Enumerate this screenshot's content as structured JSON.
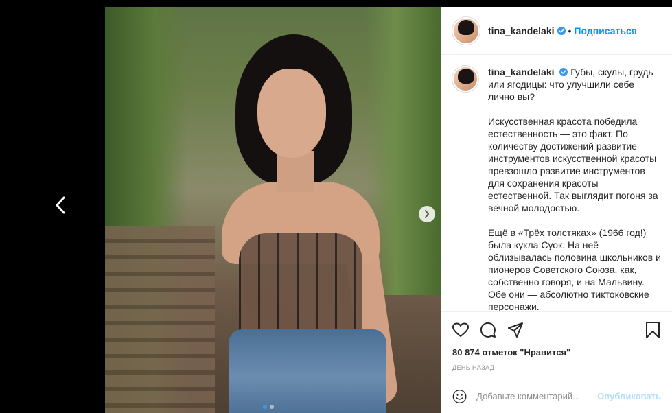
{
  "post": {
    "username": "tina_kandelaki",
    "follow_label": "Подписаться",
    "separator": "•",
    "caption_paragraphs": [
      "Губы, скулы, грудь или ягодицы: что улучшили себе лично вы?",
      "Искусственная красота победила естественность — это факт. По количеству достижений развитие инструментов искусственной красоты превзошло развитие инструментов для сохранения красоты естественной. Так выглядит погоня за вечной молодостью.",
      "Ещё в «Трёх толстяках» (1966 год!) была кукла Суок. На неё облизывалась половина школьников и пионеров Советского Союза, как, собственно говоря, и на Мальвину. Обе они — абсолютно тиктоковские персонажи."
    ],
    "likes": "80 874 отметок \"Нравится\"",
    "time": "ДЕНЬ НАЗАД",
    "media": {
      "slide_count": 2,
      "active_slide": 1
    }
  },
  "comment": {
    "placeholder": "Добавьте комментарий...",
    "publish_label": "Опубликовать"
  },
  "icons": {
    "verified": "verified-badge-icon",
    "prev": "chevron-left-icon",
    "next": "chevron-right-icon",
    "like": "heart-icon",
    "comment": "comment-icon",
    "share": "share-icon",
    "save": "bookmark-icon",
    "emoji": "emoji-icon"
  },
  "colors": {
    "accent": "#0095f6",
    "verified": "#3897f0",
    "publish_disabled": "#b2dffc"
  }
}
